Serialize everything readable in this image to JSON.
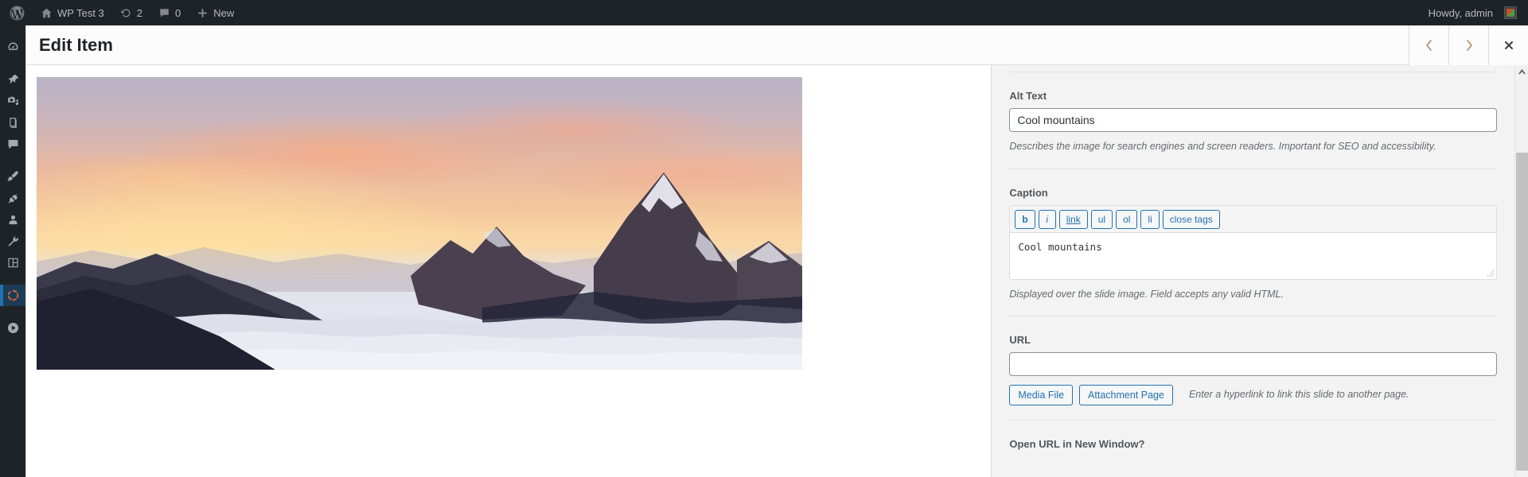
{
  "adminbar": {
    "wp_logo": "wordpress-logo-icon",
    "site": {
      "icon": "home-icon",
      "label": "WP Test 3"
    },
    "updates": {
      "icon": "updates-icon",
      "count": "2"
    },
    "comments": {
      "icon": "comment-bubble-icon",
      "count": "0"
    },
    "new": {
      "icon": "plus-icon",
      "label": "New"
    },
    "howdy": "Howdy, admin",
    "avatar": "user-avatar"
  },
  "adminmenu": {
    "items": [
      {
        "name": "dashboard",
        "icon": "dashboard-gauge-icon",
        "current": false
      },
      {
        "name": "posts",
        "icon": "pushpin-icon",
        "current": false
      },
      {
        "name": "media",
        "icon": "media-camera-music-icon",
        "current": false
      },
      {
        "name": "pages",
        "icon": "pages-icon",
        "current": false
      },
      {
        "name": "comments",
        "icon": "comment-bubble-icon",
        "current": false
      },
      {
        "name": "appearance",
        "icon": "paintbrush-icon",
        "current": false
      },
      {
        "name": "plugins",
        "icon": "plug-icon",
        "current": false
      },
      {
        "name": "users",
        "icon": "user-icon",
        "current": false
      },
      {
        "name": "tools",
        "icon": "wrench-icon",
        "current": false
      },
      {
        "name": "settings",
        "icon": "settings-sliders-icon",
        "current": false
      },
      {
        "name": "slider",
        "icon": "slider-revolution-circle-icon",
        "current": true
      },
      {
        "name": "player",
        "icon": "play-circle-icon",
        "current": false
      }
    ]
  },
  "modal": {
    "title": "Edit Item",
    "prev_label": "‹",
    "next_label": "›",
    "close_label": "✕",
    "prev_name": "previous-item-button",
    "next_name": "next-item-button",
    "close_name": "close-modal-button"
  },
  "media": {
    "alt": "Cool mountains",
    "description": "Mountain range at sunset above a sea of clouds"
  },
  "settings": {
    "alt_text": {
      "label": "Alt Text",
      "value": "Cool mountains",
      "placeholder": "",
      "help": "Describes the image for search engines and screen readers. Important for SEO and accessibility."
    },
    "caption": {
      "label": "Caption",
      "value": "Cool mountains",
      "help": "Displayed over the slide image. Field accepts any valid HTML.",
      "quicktags": [
        {
          "key": "b",
          "label": "b"
        },
        {
          "key": "i",
          "label": "i"
        },
        {
          "key": "link",
          "label": "link"
        },
        {
          "key": "ul",
          "label": "ul"
        },
        {
          "key": "ol",
          "label": "ol"
        },
        {
          "key": "li",
          "label": "li"
        },
        {
          "key": "closetags",
          "label": "close tags"
        }
      ]
    },
    "url": {
      "label": "URL",
      "value": "",
      "placeholder": "",
      "media_file_label": "Media File",
      "attachment_page_label": "Attachment Page",
      "help": "Enter a hyperlink to link this slide to another page."
    },
    "open_new_window": {
      "label": "Open URL in New Window?"
    }
  },
  "colors": {
    "admin_bg": "#1d2327",
    "accent_blue": "#2271b1",
    "current_menu_bg": "#1c3c55",
    "panel_bg": "#f3f3f3",
    "border": "#dddddd",
    "label_text": "#50575e",
    "help_text": "#646970"
  }
}
